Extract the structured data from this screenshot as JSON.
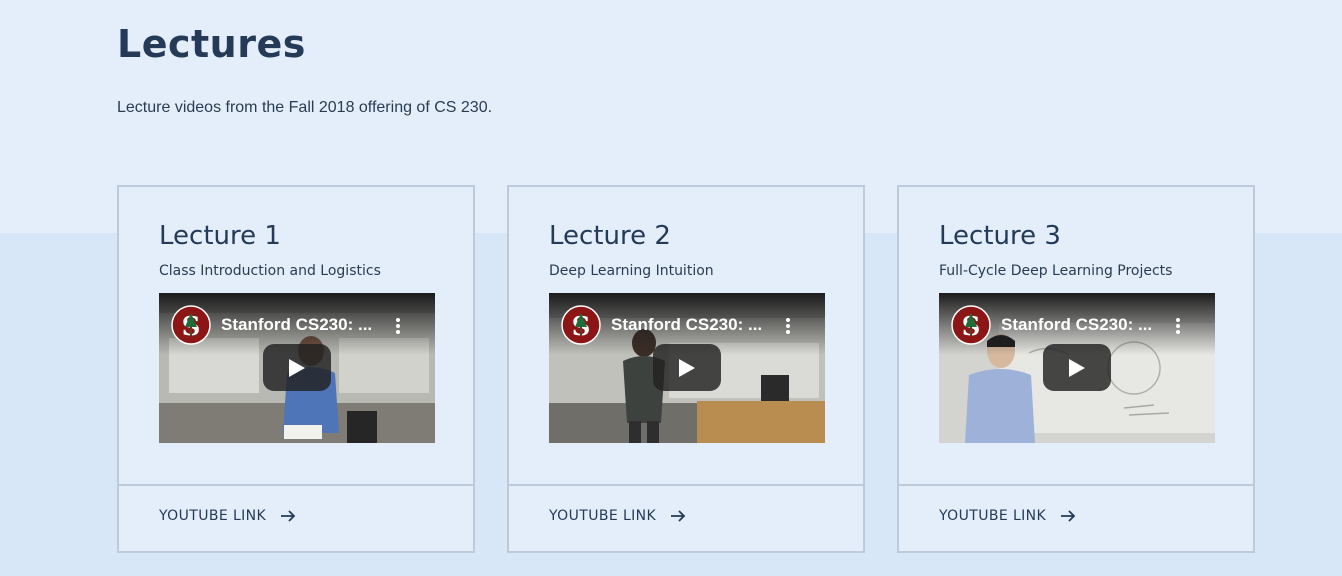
{
  "page": {
    "title": "Lectures",
    "subtitle": "Lecture videos from the Fall 2018 offering of CS 230."
  },
  "lectures": [
    {
      "title": "Lecture 1",
      "description": "Class Introduction and Logistics",
      "video": {
        "title": "Stanford CS230: ...",
        "logo_icon": "stanford-tree-logo-icon",
        "menu_icon": "more-vert-icon",
        "play_icon": "play-icon"
      },
      "link_label": "YOUTUBE LINK",
      "link_icon": "arrow-right-icon"
    },
    {
      "title": "Lecture 2",
      "description": "Deep Learning Intuition",
      "video": {
        "title": "Stanford CS230: ...",
        "logo_icon": "stanford-tree-logo-icon",
        "menu_icon": "more-vert-icon",
        "play_icon": "play-icon"
      },
      "link_label": "YOUTUBE LINK",
      "link_icon": "arrow-right-icon"
    },
    {
      "title": "Lecture 3",
      "description": "Full-Cycle Deep Learning Projects",
      "video": {
        "title": "Stanford CS230: ...",
        "logo_icon": "stanford-tree-logo-icon",
        "menu_icon": "more-vert-icon",
        "play_icon": "play-icon"
      },
      "link_label": "YOUTUBE LINK",
      "link_icon": "arrow-right-icon"
    }
  ],
  "colors": {
    "background": "#e3eefa",
    "text": "#243a57",
    "card_border": "#bccadb",
    "stanford_red": "#8c1515"
  }
}
